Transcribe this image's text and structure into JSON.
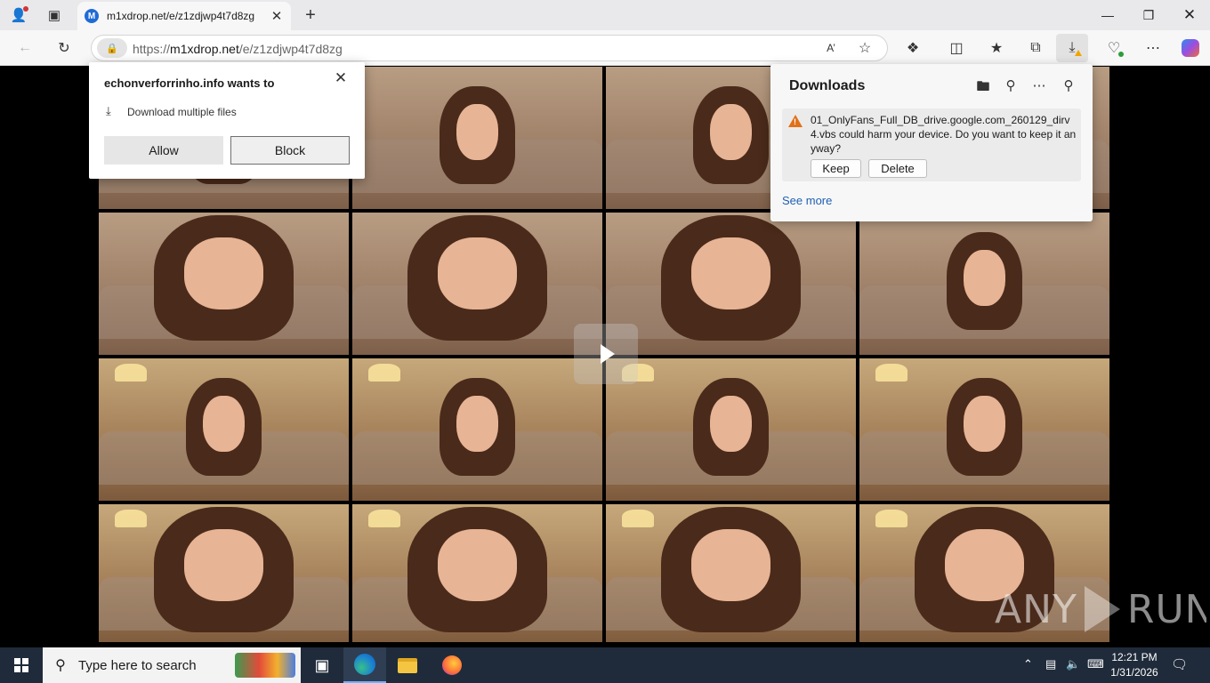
{
  "browser": {
    "tab_title": "m1xdrop.net/e/z1zdjwp4t7d8zg",
    "favicon_letter": "M",
    "url_scheme": "https://",
    "url_host": "m1xdrop.net",
    "url_path": "/e/z1zdjwp4t7d8zg"
  },
  "permission_popup": {
    "title": "echonverforrinho.info wants to",
    "request": "Download multiple files",
    "allow_label": "Allow",
    "block_label": "Block"
  },
  "downloads_panel": {
    "title": "Downloads",
    "warning_message": "01_OnlyFans_Full_DB_drive.google.com_260129_dirv4.vbs could harm your device. Do you want to keep it anyway?",
    "keep_label": "Keep",
    "delete_label": "Delete",
    "see_more_label": "See more"
  },
  "video": {
    "thumbnail_count": 16,
    "watermark_left": "ANY",
    "watermark_right": "RUN"
  },
  "taskbar": {
    "search_placeholder": "Type here to search",
    "time": "12:21 PM",
    "date": "1/31/2026"
  },
  "colors": {
    "accent": "#1f6bd6",
    "warning": "#e0701a",
    "link": "#1f5fb4",
    "taskbar": "#1f2b3a"
  }
}
